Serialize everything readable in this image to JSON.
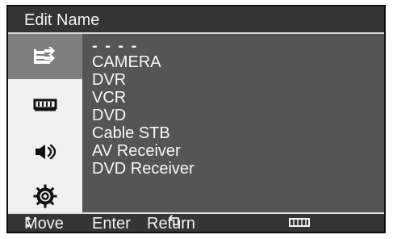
{
  "window": {
    "title": "Edit Name"
  },
  "sidebar": {
    "items": [
      {
        "icon": "input-icon",
        "active": true
      },
      {
        "icon": "picture-icon",
        "active": false
      },
      {
        "icon": "sound-icon",
        "active": false
      },
      {
        "icon": "setup-icon",
        "active": false
      }
    ]
  },
  "content": {
    "items": [
      "- - - -",
      "CAMERA",
      "DVR",
      "VCR",
      "DVD",
      "Cable STB",
      "AV Receiver",
      "DVD Receiver"
    ]
  },
  "footer": {
    "move": "Move",
    "enter": "Enter",
    "return": "Return",
    "icon": "menu-icon"
  },
  "colors": {
    "background": "#555555",
    "title_bar": "#333333",
    "sidebar": "#f0f0f0",
    "selected_sidebar": "#7f7f7f",
    "text": "#f7f7f7",
    "footer": "#353535"
  }
}
